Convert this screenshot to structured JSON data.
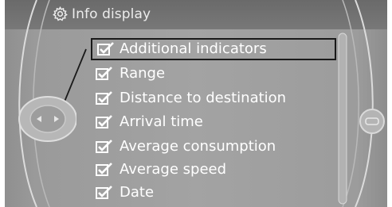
{
  "header": {
    "title": "Info display",
    "icon": "gear-icon"
  },
  "menu": {
    "items": [
      {
        "label": "Additional indicators",
        "checked": true,
        "selected": true
      },
      {
        "label": "Range",
        "checked": true,
        "selected": false
      },
      {
        "label": "Distance to destination",
        "checked": true,
        "selected": false
      },
      {
        "label": "Arrival time",
        "checked": true,
        "selected": false
      },
      {
        "label": "Average consumption",
        "checked": true,
        "selected": false
      },
      {
        "label": "Average speed",
        "checked": true,
        "selected": false
      },
      {
        "label": "Date",
        "checked": true,
        "selected": false
      }
    ]
  },
  "colors": {
    "background": "#a0a0a0",
    "header": "#707070",
    "text": "#ffffff",
    "highlight_border": "#1a1a1a"
  }
}
